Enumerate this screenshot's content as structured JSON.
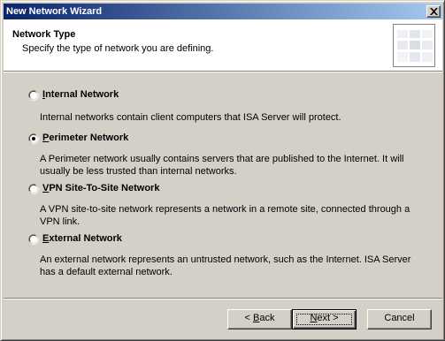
{
  "window": {
    "title": "New Network Wizard",
    "close_glyph": "×"
  },
  "header": {
    "title": "Network Type",
    "subtitle": "Specify the type of network you are defining."
  },
  "options": [
    {
      "label_prefix": "",
      "label_mnemonic": "I",
      "label_rest": "nternal Network",
      "selected": false,
      "description": "Internal networks contain client computers that ISA Server will protect."
    },
    {
      "label_prefix": "",
      "label_mnemonic": "P",
      "label_rest": "erimeter Network",
      "selected": true,
      "description": "A Perimeter network usually contains servers that are published to the Internet. It will usually be less trusted than internal networks."
    },
    {
      "label_prefix": "",
      "label_mnemonic": "V",
      "label_rest": "PN Site-To-Site Network",
      "selected": false,
      "description": "A VPN site-to-site network represents a network in a remote site, connected through a VPN link."
    },
    {
      "label_prefix": "",
      "label_mnemonic": "E",
      "label_rest": "xternal Network",
      "selected": false,
      "description": "An external network represents an untrusted network, such as the Internet. ISA Server has a default external network."
    }
  ],
  "buttons": {
    "back": {
      "prefix": "< ",
      "mnemonic": "B",
      "rest": "ack"
    },
    "next": {
      "prefix": "",
      "mnemonic": "N",
      "rest": "ext >"
    },
    "cancel": "Cancel"
  },
  "colors": {
    "titlebar_start": "#0a246a",
    "titlebar_end": "#a6caf0",
    "face": "#d4d0c8"
  }
}
